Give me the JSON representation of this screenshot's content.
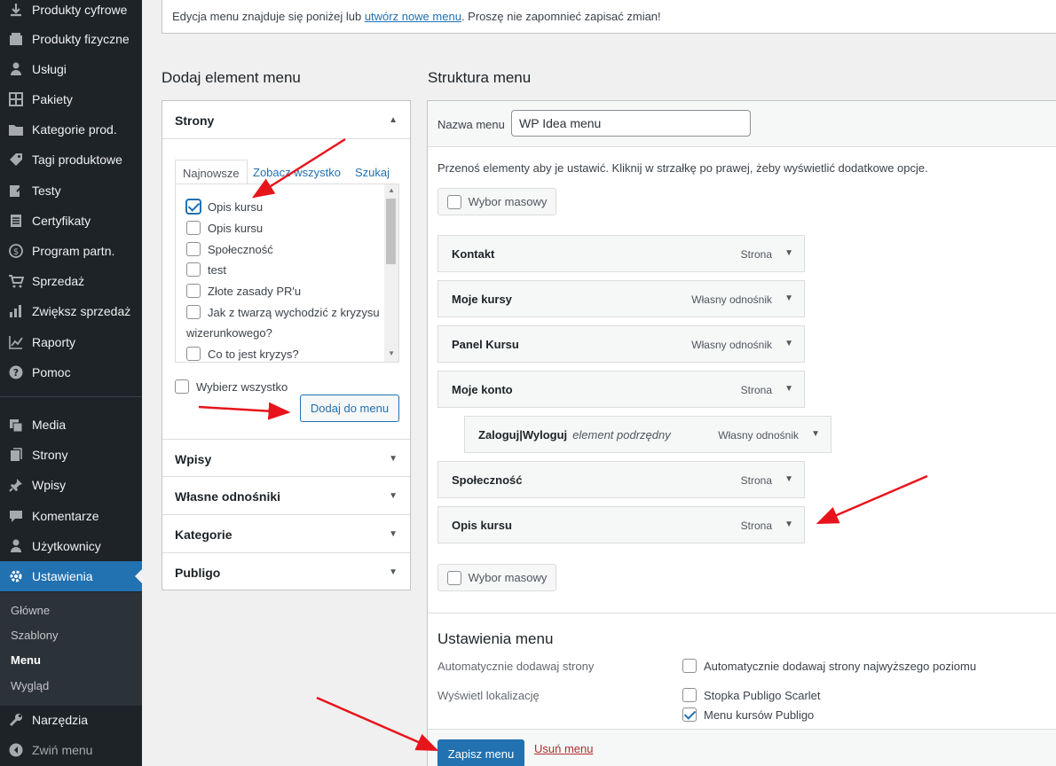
{
  "sidebar": {
    "items": [
      {
        "label": "Produkty cyfrowe",
        "icon": "download-icon"
      },
      {
        "label": "Produkty fizyczne",
        "icon": "box-icon"
      },
      {
        "label": "Usługi",
        "icon": "person-icon"
      },
      {
        "label": "Pakiety",
        "icon": "grid-icon"
      },
      {
        "label": "Kategorie prod.",
        "icon": "folder-icon"
      },
      {
        "label": "Tagi produktowe",
        "icon": "tag-icon"
      },
      {
        "label": "Testy",
        "icon": "edit-icon"
      },
      {
        "label": "Certyfikaty",
        "icon": "document-icon"
      },
      {
        "label": "Program partn.",
        "icon": "dollar-icon"
      },
      {
        "label": "Sprzedaż",
        "icon": "cart-icon"
      },
      {
        "label": "Zwiększ sprzedaż",
        "icon": "bar-chart-icon"
      },
      {
        "label": "Raporty",
        "icon": "line-chart-icon"
      },
      {
        "label": "Pomoc",
        "icon": "help-icon"
      },
      {
        "label": "Media",
        "icon": "media-icon"
      },
      {
        "label": "Strony",
        "icon": "pages-icon"
      },
      {
        "label": "Wpisy",
        "icon": "pin-icon"
      },
      {
        "label": "Komentarze",
        "icon": "comment-icon"
      },
      {
        "label": "Użytkownicy",
        "icon": "users-icon"
      },
      {
        "label": "Ustawienia",
        "icon": "settings-icon"
      },
      {
        "label": "Narzędzia",
        "icon": "wrench-icon"
      },
      {
        "label": "Zwiń menu",
        "icon": "collapse-icon"
      }
    ],
    "submenu": [
      "Główne",
      "Szablony",
      "Menu",
      "Wygląd"
    ],
    "active_color": "#2271b1"
  },
  "notice": {
    "before": "Edycja menu znajduje się poniżej lub ",
    "link": "utwórz nowe menu",
    "after": ". Proszę nie zapomnieć zapisać zmian!"
  },
  "left": {
    "heading": "Dodaj element menu",
    "pages_section": "Strony",
    "tabs": [
      "Najnowsze",
      "Zobacz wszystko",
      "Szukaj"
    ],
    "pages": [
      {
        "label": "Opis kursu",
        "checked": true
      },
      {
        "label": "Opis kursu",
        "checked": false
      },
      {
        "label": "Społeczność",
        "checked": false
      },
      {
        "label": "test",
        "checked": false
      },
      {
        "label": "Złote zasady PR'u",
        "checked": false
      },
      {
        "label": "Jak z twarzą wychodzić z kryzysu",
        "checked": false
      },
      {
        "label": "wizerunkowego?",
        "checked": false
      },
      {
        "label": "Co to jest kryzys?",
        "checked": false
      }
    ],
    "select_all": "Wybierz wszystko",
    "add_button": "Dodaj do menu",
    "sections": [
      "Wpisy",
      "Własne odnośniki",
      "Kategorie",
      "Publigo"
    ]
  },
  "right": {
    "heading": "Struktura menu",
    "name_label": "Nazwa menu",
    "name_value": "WP Idea menu",
    "instructions": "Przenoś elementy aby je ustawić. Kliknij w strzałkę po prawej, żeby wyświetlić dodatkowe opcje.",
    "bulk": "Wybor masowy",
    "items": [
      {
        "title": "Kontakt",
        "sub": "",
        "type": "Strona"
      },
      {
        "title": "Moje kursy",
        "sub": "",
        "type": "Własny odnośnik"
      },
      {
        "title": "Panel Kursu",
        "sub": "",
        "type": "Własny odnośnik"
      },
      {
        "title": "Moje konto",
        "sub": "",
        "type": "Strona"
      },
      {
        "title": "Zaloguj|Wyloguj",
        "sub": "element podrzędny",
        "type": "Własny odnośnik"
      },
      {
        "title": "Społeczność",
        "sub": "",
        "type": "Strona"
      },
      {
        "title": "Opis kursu",
        "sub": "",
        "type": "Strona"
      }
    ],
    "settings_heading": "Ustawienia menu",
    "auto_add_label": "Automatycznie dodawaj strony",
    "auto_add_option": "Automatycznie dodawaj strony najwyższego poziomu",
    "locations_label": "Wyświetl lokalizację",
    "locations": [
      {
        "label": "Stopka Publigo Scarlet",
        "checked": false
      },
      {
        "label": "Menu kursów Publigo",
        "checked": true
      }
    ],
    "save": "Zapisz menu",
    "delete": "Usuń menu"
  }
}
